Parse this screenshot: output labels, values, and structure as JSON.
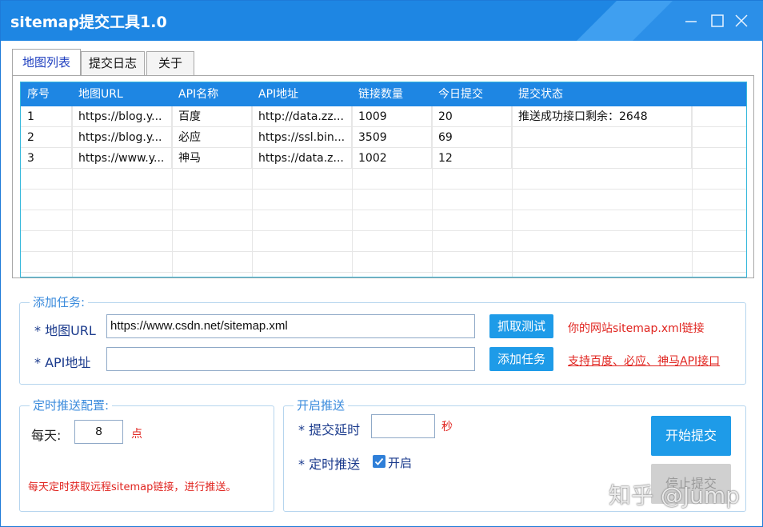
{
  "window": {
    "title": "sitemap提交工具1.0"
  },
  "tabs": [
    {
      "label": "地图列表",
      "active": true
    },
    {
      "label": "提交日志",
      "active": false
    },
    {
      "label": "关于",
      "active": false
    }
  ],
  "table": {
    "columns": [
      "序号",
      "地图URL",
      "API名称",
      "API地址",
      "链接数量",
      "今日提交",
      "提交状态"
    ],
    "rows": [
      [
        "1",
        "https://blog.y...",
        "百度",
        "http://data.zz...",
        "1009",
        "20",
        "推送成功接口剩余：2648"
      ],
      [
        "2",
        "https://blog.y...",
        "必应",
        "https://ssl.bin...",
        "3509",
        "69",
        ""
      ],
      [
        "3",
        "https://www.y...",
        "神马",
        "https://data.z...",
        "1002",
        "12",
        ""
      ]
    ]
  },
  "add_task": {
    "group_title": "添加任务:",
    "map_url_label": "* 地图URL",
    "map_url_value": "https://www.csdn.net/sitemap.xml",
    "fetch_button": "抓取测试",
    "map_url_hint": "你的网站sitemap.xml链接",
    "api_label": "* API地址",
    "api_value": "",
    "add_button": "添加任务",
    "api_hint": "支持百度、必应、神马API接口"
  },
  "schedule": {
    "group_title": "定时推送配置:",
    "daily_label": "每天:",
    "hour_value": "8",
    "hour_unit": "点",
    "note": "每天定时获取远程sitemap链接，进行推送。"
  },
  "push": {
    "group_title": "开启推送",
    "delay_label": "* 提交延时",
    "delay_value": "",
    "delay_unit": "秒",
    "timed_label": "* 定时推送",
    "timed_checkbox_label": "开启",
    "timed_checked": true,
    "start_button": "开始提交",
    "stop_button": "停止提交"
  },
  "watermark": "知乎 @Jump",
  "colors": {
    "titlebar": "#1e86e3",
    "accent_button": "#1e9be8",
    "hint_red": "#e0241f",
    "group_title": "#3b8bdc"
  }
}
